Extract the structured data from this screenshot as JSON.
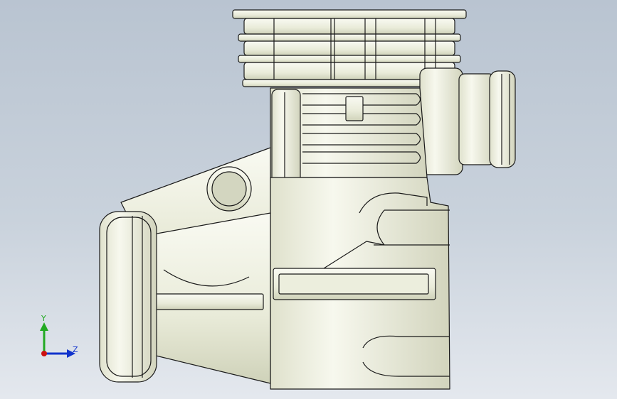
{
  "viewport": {
    "background_top": "#b9c4d1",
    "background_bottom": "#e4e8ee"
  },
  "model": {
    "part_fill": "#f4f5ea",
    "part_shade": "#d6d8c4",
    "edge_color": "#1a1a1a"
  },
  "triad": {
    "x_axis_color": "#cc1111",
    "y_axis_color": "#22aa22",
    "z_axis_color": "#1133cc",
    "y_label": "Y",
    "z_label": "Z"
  }
}
